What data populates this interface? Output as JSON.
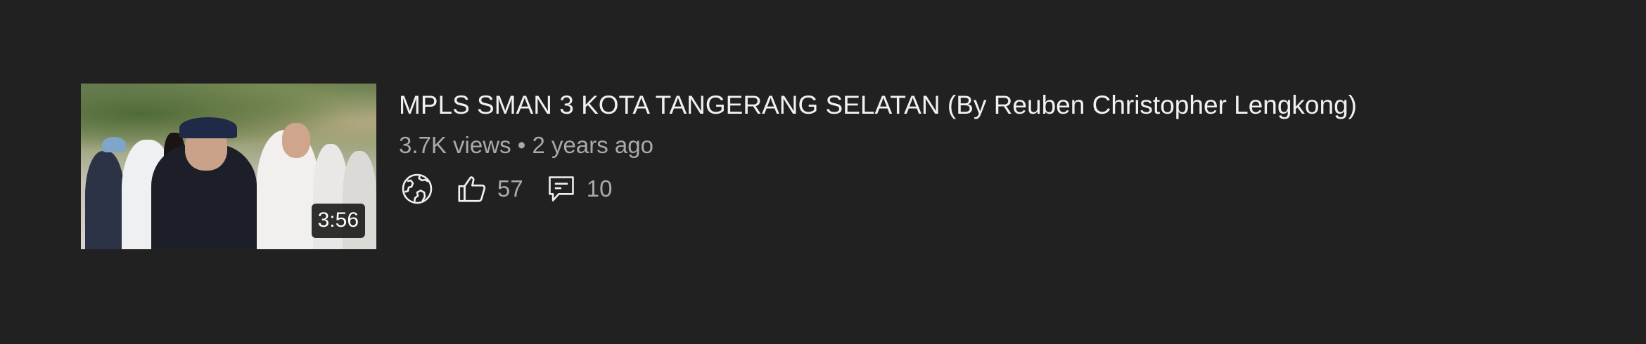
{
  "video": {
    "title": "MPLS SMAN 3 KOTA TANGERANG SELATAN (By Reuben Christopher Lengkong)",
    "duration": "3:56",
    "views": "3.7K views",
    "separator": "•",
    "age": "2 years ago",
    "visibility_icon": "globe-icon",
    "likes": "57",
    "comments": "10"
  },
  "colors": {
    "background": "#212121",
    "title_text": "#f1f1f1",
    "secondary_text": "#aaaaaa"
  }
}
